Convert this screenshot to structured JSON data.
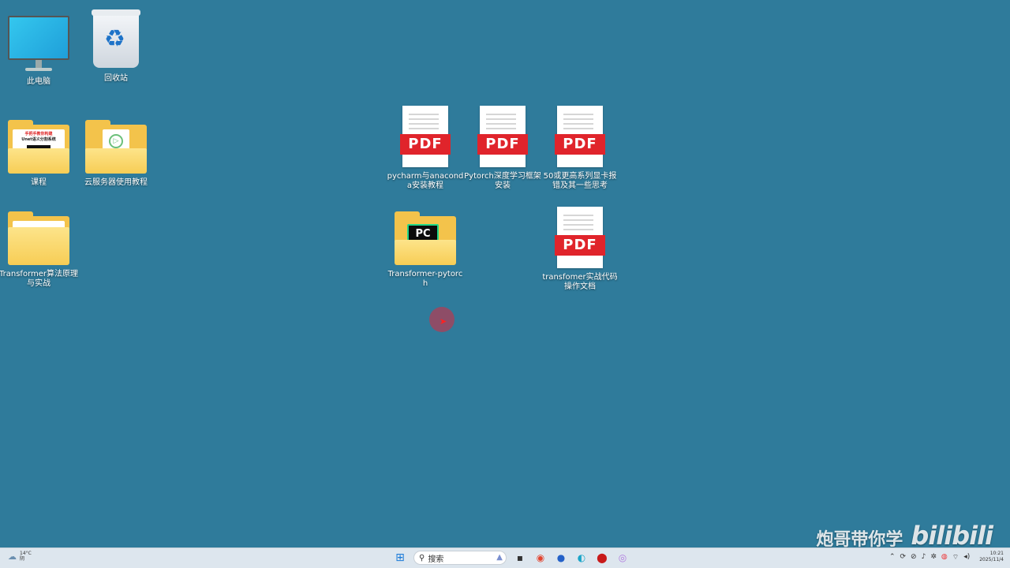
{
  "desktop": {
    "icons": [
      {
        "label": "此电脑"
      },
      {
        "label": "回收站"
      },
      {
        "label": "课程",
        "thumb_line1": "手把手教你构建",
        "thumb_line2": "Unet语义分割系统"
      },
      {
        "label": "云服务器使用教程"
      },
      {
        "label": "Transformer算法原理与实战"
      },
      {
        "label": "pycharm与anaconda安装教程",
        "badge": "PDF"
      },
      {
        "label": "Pytorch深度学习框架安装",
        "badge": "PDF"
      },
      {
        "label": "50或更高系列显卡报错及其一些思考",
        "badge": "PDF"
      },
      {
        "label": "Transformer-pytorch",
        "badge": "PC"
      },
      {
        "label": "transfomer实战代码操作文档",
        "badge": "PDF"
      }
    ]
  },
  "watermark": {
    "text": "炮哥带你学",
    "logo": "bilibili"
  },
  "taskbar": {
    "weather": {
      "temp": "14°C",
      "condition": "阴"
    },
    "search_placeholder": "搜索",
    "apps": [
      "start-icon",
      "task-view-icon",
      "chrome-icon",
      "maps-icon",
      "edge-icon",
      "recorder-icon",
      "app-icon"
    ],
    "clock": {
      "time": "10:21",
      "date": "2025/11/4"
    }
  }
}
